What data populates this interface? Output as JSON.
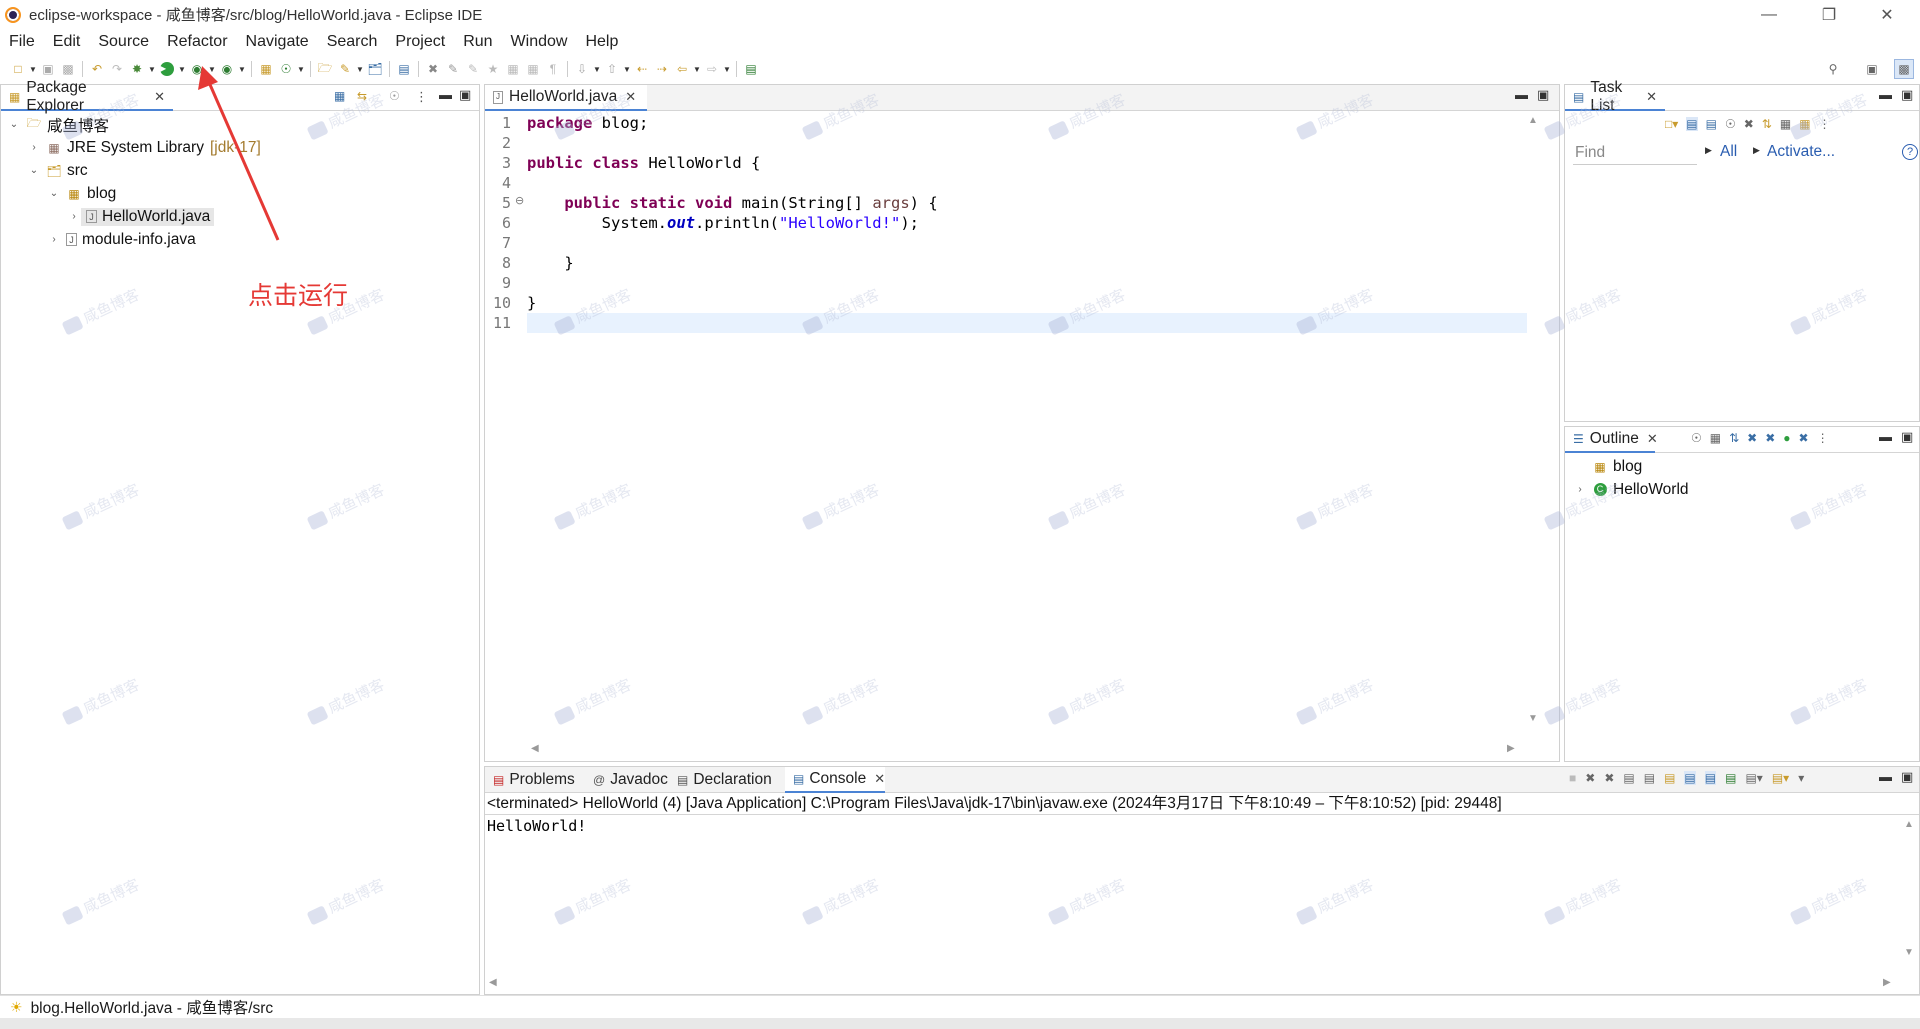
{
  "window": {
    "title": "eclipse-workspace - 咸鱼博客/src/blog/HelloWorld.java - Eclipse IDE"
  },
  "menu": [
    "File",
    "Edit",
    "Source",
    "Refactor",
    "Navigate",
    "Search",
    "Project",
    "Run",
    "Window",
    "Help"
  ],
  "package_explorer": {
    "tab_label": "Package Explorer",
    "tree": {
      "project": "咸鱼博客",
      "jre": "JRE System Library",
      "jre_suffix": "[jdk-17]",
      "src": "src",
      "package": "blog",
      "file": "HelloWorld.java",
      "module_info": "module-info.java"
    }
  },
  "annotation": {
    "text": "点击运行",
    "color": "#e53935"
  },
  "editor": {
    "tab_label": "HelloWorld.java",
    "line_numbers": [
      "1",
      "2",
      "3",
      "4",
      "5",
      "6",
      "7",
      "8",
      "9",
      "10",
      "11"
    ],
    "code": {
      "l1_kw": "package",
      "l1_rest": " blog;",
      "l3_kw1": "public",
      "l3_kw2": "class",
      "l3_rest": " HelloWorld {",
      "l5_kw1": "public",
      "l5_kw2": "static",
      "l5_kw3": "void",
      "l5_mid": " main(String[] ",
      "l5_param": "args",
      "l5_end": ") {",
      "l6_a": "System.",
      "l6_field": "out",
      "l6_b": ".println(",
      "l6_str": "\"HelloWorld!\"",
      "l6_c": ");",
      "l8": "}",
      "l10": "}"
    }
  },
  "task_list": {
    "tab_label": "Task List",
    "find_placeholder": "Find",
    "all_link": "All",
    "activate_link": "Activate..."
  },
  "outline": {
    "tab_label": "Outline",
    "items": [
      "blog",
      "HelloWorld"
    ]
  },
  "bottom_tabs": {
    "problems": "Problems",
    "javadoc": "Javadoc",
    "declaration": "Declaration",
    "console": "Console"
  },
  "console": {
    "header": "<terminated> HelloWorld (4) [Java Application] C:\\Program Files\\Java\\jdk-17\\bin\\javaw.exe  (2024年3月17日 下午8:10:49 – 下午8:10:52) [pid: 29448]",
    "output": "HelloWorld!"
  },
  "status_bar": {
    "text": "blog.HelloWorld.java - 咸鱼博客/src"
  },
  "colors": {
    "accent": "#4b83d4",
    "keyword": "#7f0055",
    "string": "#2a00ff",
    "current_line": "#e8f2fe"
  },
  "watermark": {
    "text": "咸鱼博客"
  }
}
